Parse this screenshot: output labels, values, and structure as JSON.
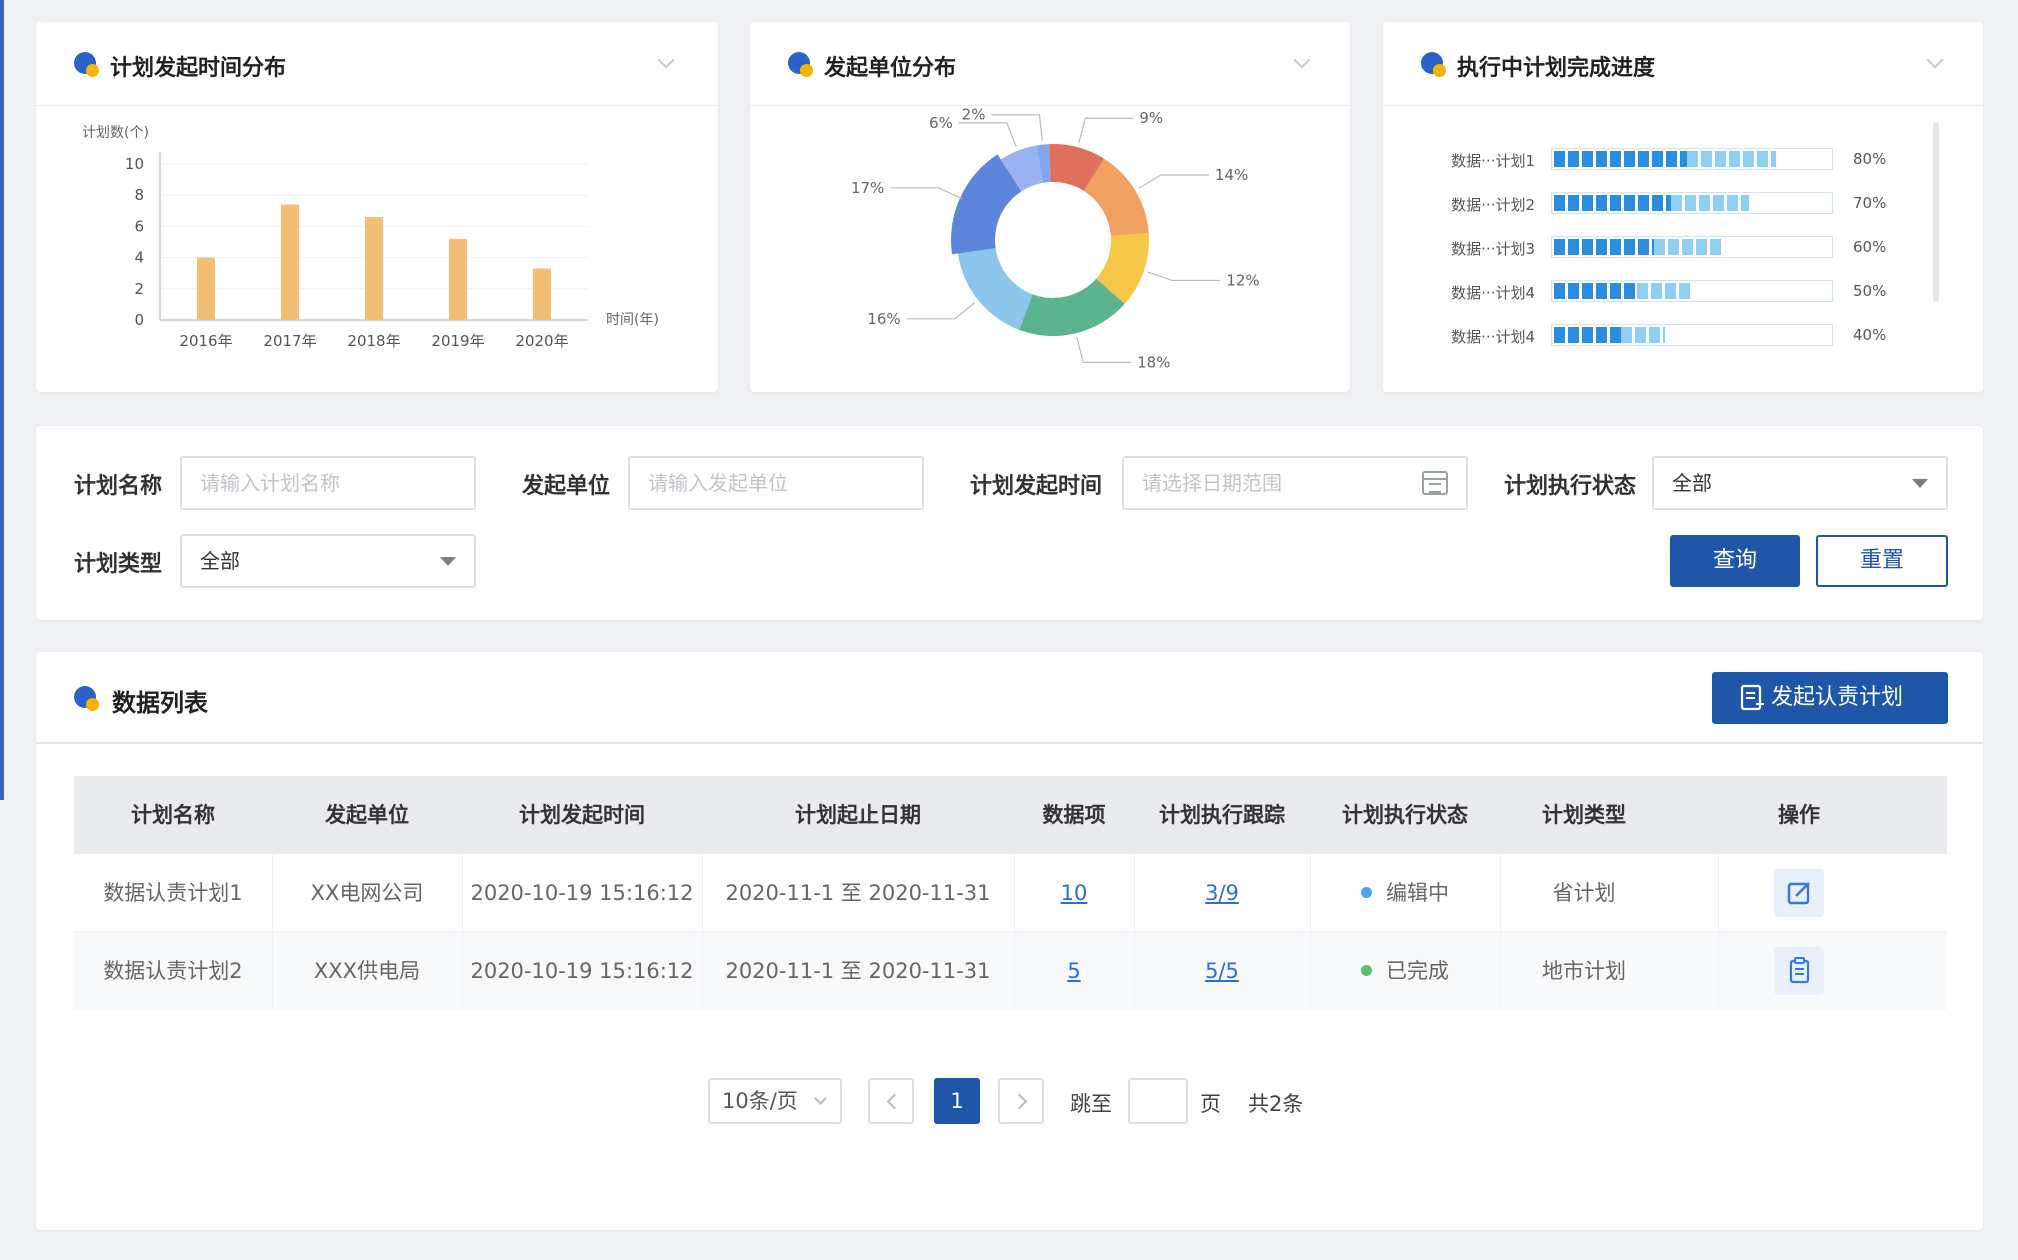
{
  "colors": {
    "primary": "#1f56a8",
    "bar": "#f2bf78",
    "link": "#2a6fd4",
    "status_editing": "#4aa7ee",
    "status_done": "#5cc06c"
  },
  "charts_header": {
    "time_dist_title": "计划发起时间分布",
    "unit_dist_title": "发起单位分布",
    "progress_title": "执行中计划完成进度"
  },
  "chart_data": [
    {
      "type": "bar",
      "ylabel": "计划数(个)",
      "xlabel": "时间(年)",
      "categories": [
        "2016年",
        "2017年",
        "2018年",
        "2019年",
        "2020年"
      ],
      "values": [
        4,
        7.4,
        6.6,
        5.2,
        3.3
      ],
      "ylim": [
        0,
        10
      ],
      "yticks": [
        0,
        2,
        4,
        6,
        8,
        10
      ],
      "color": "#f2bf78"
    },
    {
      "type": "pie",
      "slices": [
        {
          "label": "2%",
          "value": 2,
          "color": "#7fa6ee"
        },
        {
          "label": "9%",
          "value": 9,
          "color": "#e0705c"
        },
        {
          "label": "14%",
          "value": 14,
          "color": "#f0a060"
        },
        {
          "label": "12%",
          "value": 12,
          "color": "#f5c84a"
        },
        {
          "label": "18%",
          "value": 18,
          "color": "#5cb48e"
        },
        {
          "label": "16%",
          "value": 16,
          "color": "#8cc6ec"
        },
        {
          "label": "17%",
          "value": 17,
          "color": "#5b86dc"
        },
        {
          "label": "6%",
          "value": 6,
          "color": "#9ab2f0"
        }
      ]
    },
    {
      "type": "bar",
      "orientation": "horizontal",
      "categories": [
        "数据···计划1",
        "数据···计划2",
        "数据···计划3",
        "数据···计划4",
        "数据···计划4"
      ],
      "values": [
        80,
        70,
        60,
        50,
        40
      ],
      "value_labels": [
        "80%",
        "70%",
        "60%",
        "50%",
        "40%"
      ],
      "xlim": [
        0,
        100
      ]
    }
  ],
  "filter": {
    "name_label": "计划名称",
    "name_placeholder": "请输入计划名称",
    "unit_label": "发起单位",
    "unit_placeholder": "请输入发起单位",
    "time_label": "计划发起时间",
    "time_placeholder": "请选择日期范围",
    "status_label": "计划执行状态",
    "status_value": "全部",
    "type_label": "计划类型",
    "type_value": "全部",
    "query_button": "查询",
    "reset_button": "重置"
  },
  "list": {
    "title": "数据列表",
    "create_button": "发起认责计划",
    "columns": [
      "计划名称",
      "发起单位",
      "计划发起时间",
      "计划起止日期",
      "数据项",
      "计划执行跟踪",
      "计划执行状态",
      "计划类型",
      "操作"
    ],
    "rows": [
      {
        "name": "数据认责计划1",
        "unit": "XX电网公司",
        "time": "2020-10-19 15:16:12",
        "range": "2020-11-1 至 2020-11-31",
        "items": "10",
        "track": "3/9",
        "status": "编辑中",
        "type": "省计划"
      },
      {
        "name": "数据认责计划2",
        "unit": "XXX供电局",
        "time": "2020-10-19 15:16:12",
        "range": "2020-11-1 至 2020-11-31",
        "items": "5",
        "track": "5/5",
        "status": "已完成",
        "type": "地市计划"
      }
    ]
  },
  "pagination": {
    "page_size": "10条/页",
    "current_page": "1",
    "goto_label": "跳至",
    "page_unit": "页",
    "total": "共2条"
  }
}
